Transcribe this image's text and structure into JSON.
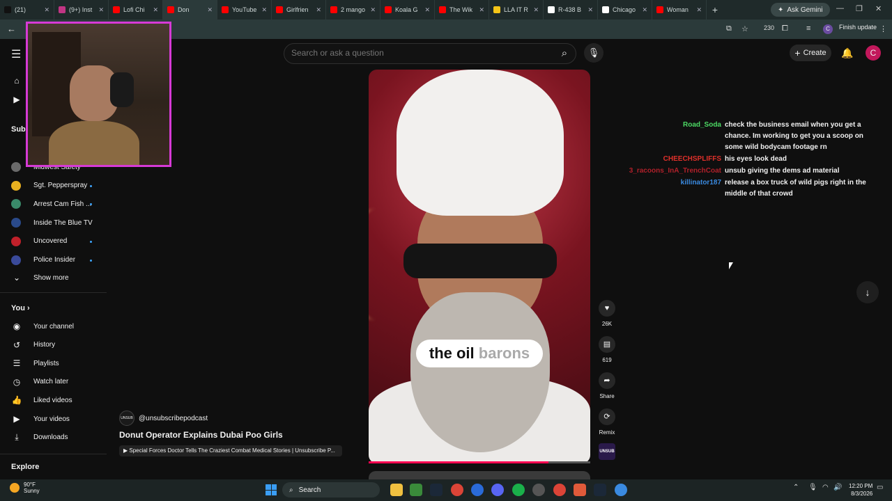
{
  "browser": {
    "tabs": [
      {
        "label": "(21)",
        "color": "#111111"
      },
      {
        "label": "(9+) Inst",
        "color": "#c13584"
      },
      {
        "label": "Lofi Chi",
        "color": "#ff0000"
      },
      {
        "label": "Don",
        "color": "#ff0000"
      },
      {
        "label": "YouTube",
        "color": "#ff0000"
      },
      {
        "label": "Girlfrien",
        "color": "#ff0000"
      },
      {
        "label": "2 mango",
        "color": "#ff0000"
      },
      {
        "label": "Koala G",
        "color": "#ff0000"
      },
      {
        "label": "The Wik",
        "color": "#ff0000"
      },
      {
        "label": "LLA IT R",
        "color": "#f5c518"
      },
      {
        "label": "R-438 B",
        "color": "#ffffff"
      },
      {
        "label": "Chicago",
        "color": "#ffffff"
      },
      {
        "label": "Woman",
        "color": "#ff0000"
      }
    ],
    "active_tab_index": 3,
    "ask_gemini": "Ask Gemini",
    "finish_update": "Finish update",
    "extension_badge": "230",
    "profile_initial": "C"
  },
  "header": {
    "search_placeholder": "Search or ask a question",
    "create_label": "Create",
    "avatar_initial": "C"
  },
  "sidebar": {
    "subs_head": "Subs",
    "subscriptions": [
      {
        "label": "Midwest Safety",
        "color": "#6a6a6a",
        "dot": false
      },
      {
        "label": "Sgt. Pepperspray",
        "color": "#e8b020",
        "dot": true
      },
      {
        "label": "Arrest Cam Fish ...",
        "color": "#3a8a6a",
        "dot": true
      },
      {
        "label": "Inside The Blue TV",
        "color": "#2a4a8a",
        "dot": false
      },
      {
        "label": "Uncovered",
        "color": "#c0202a",
        "dot": true
      },
      {
        "label": "Police Insider",
        "color": "#3a4a9a",
        "dot": true
      }
    ],
    "show_more": "Show more",
    "you_head": "You",
    "you_items": [
      {
        "label": "Your channel",
        "icon": "person-icon"
      },
      {
        "label": "History",
        "icon": "history-icon"
      },
      {
        "label": "Playlists",
        "icon": "playlist-icon"
      },
      {
        "label": "Watch later",
        "icon": "clock-icon"
      },
      {
        "label": "Liked videos",
        "icon": "thumbs-up-icon"
      },
      {
        "label": "Your videos",
        "icon": "video-icon"
      },
      {
        "label": "Downloads",
        "icon": "download-icon"
      }
    ],
    "explore_head": "Explore"
  },
  "short": {
    "caption_main": "the oil ",
    "caption_fade": "barons",
    "progress": 0.81,
    "likes": "26K",
    "comments": "619",
    "share": "Share",
    "remix": "Remix",
    "thumb_label": "UNSUB",
    "channel_avatar": "UNSUB",
    "channel": "@unsubscribepodcast",
    "title": "Donut Operator Explains Dubai Poo Girls",
    "related": "Special Forces Doctor Tells The Craziest Combat Medical Stories | Unsubscribe P..."
  },
  "chat": [
    {
      "user": "Road_Soda",
      "color": "#4cd964",
      "msg": "check the business email when you get a chance. Im working to get you a scoop on some wild bodycam footage rn"
    },
    {
      "user": "CHEECHSPLIFFS",
      "color": "#e0302a",
      "msg": "his eyes look dead"
    },
    {
      "user": "3_racoons_InA_TrenchCoat",
      "color": "#b0202a",
      "msg": "unsub giving the dems ad material"
    },
    {
      "user": "killinator187",
      "color": "#3a8ae0",
      "msg": "release a box truck of wild pigs right in the middle of that crowd"
    }
  ],
  "taskbar": {
    "temp": "90°F",
    "condition": "Sunny",
    "search_label": "Search",
    "time": "12:20 PM",
    "date": "8/3/2026"
  }
}
